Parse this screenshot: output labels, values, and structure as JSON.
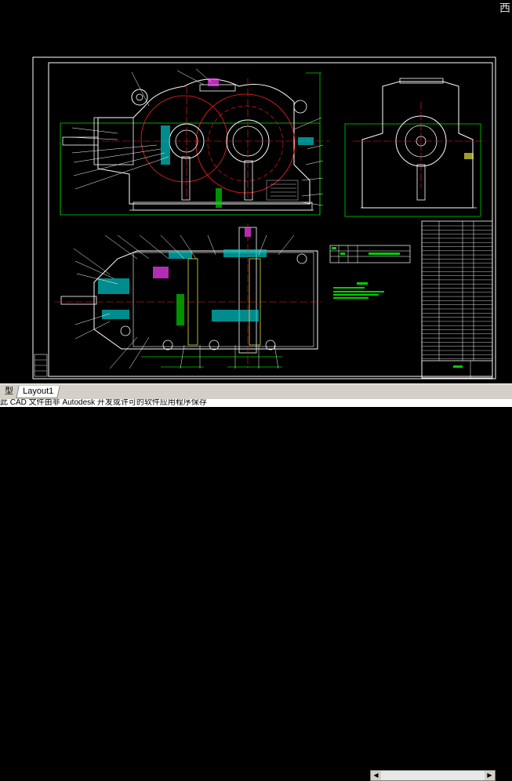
{
  "window": {
    "corner_char": "西"
  },
  "tabs": [
    {
      "label": "型"
    },
    {
      "label": "Layout1"
    }
  ],
  "status": {
    "text": "此 CAD 文件由非 Autodesk 开发或许可的软件应用程序保存"
  },
  "colors": {
    "background": "#000000",
    "border": "#ffffff",
    "outline": "#ffffff",
    "center_line": "#ff2020",
    "dim": "#00d000",
    "leader": "#ffffff",
    "cyan": "#00c8c8",
    "magenta": "#ff40ff",
    "yellow": "#e0e040"
  }
}
